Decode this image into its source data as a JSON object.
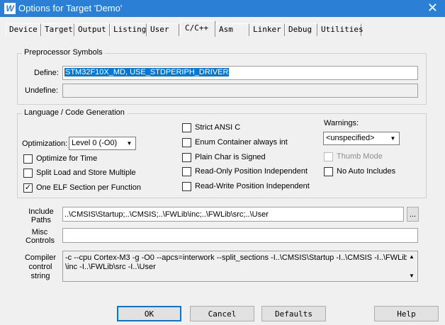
{
  "window": {
    "title": "Options for Target 'Demo'",
    "icon": "uvision-app-icon",
    "close_glyph": "✕"
  },
  "tabs": [
    {
      "label": "Device"
    },
    {
      "label": "Target"
    },
    {
      "label": "Output"
    },
    {
      "label": "Listing"
    },
    {
      "label": "User"
    },
    {
      "label": "C/C++"
    },
    {
      "label": "Asm"
    },
    {
      "label": "Linker"
    },
    {
      "label": "Debug"
    },
    {
      "label": "Utilities"
    }
  ],
  "active_tab": "C/C++",
  "preprocessor": {
    "title": "Preprocessor Symbols",
    "define_label": "Define:",
    "define_value": "STM32F10X_MD, USE_STDPERIPH_DRIVER",
    "undefine_label": "Undefine:",
    "undefine_value": ""
  },
  "language": {
    "title": "Language / Code Generation",
    "optimization_label": "Optimization:",
    "optimization_value": "Level 0 (-O0)",
    "optimize_time": {
      "label": "Optimize for Time",
      "checked": false
    },
    "split_load": {
      "label": "Split Load and Store Multiple",
      "checked": false
    },
    "one_elf": {
      "label": "One ELF Section per Function",
      "checked": true,
      "mark": "✓"
    },
    "strict_ansi": {
      "label": "Strict ANSI C",
      "checked": false
    },
    "enum_container": {
      "label": "Enum Container always int",
      "checked": false
    },
    "plain_char": {
      "label": "Plain Char is Signed",
      "checked": false
    },
    "ro_pos": {
      "label": "Read-Only Position Independent",
      "checked": false
    },
    "rw_pos": {
      "label": "Read-Write Position Independent",
      "checked": false
    },
    "warnings_label": "Warnings:",
    "warnings_value": "<unspecified>",
    "thumb_mode": {
      "label": "Thumb Mode",
      "checked": false,
      "disabled": true
    },
    "no_auto_includes": {
      "label": "No Auto Includes",
      "checked": false
    }
  },
  "include_paths": {
    "label_line1": "Include",
    "label_line2": "Paths",
    "value": "..\\CMSIS\\Startup;..\\CMSIS;..\\FWLib\\inc;..\\FWLib\\src;..\\User",
    "browse_label": "..."
  },
  "misc_controls": {
    "label_line1": "Misc",
    "label_line2": "Controls",
    "value": ""
  },
  "compiler_string": {
    "label_line1": "Compiler",
    "label_line2": "control",
    "label_line3": "string",
    "value": "-c --cpu Cortex-M3 -g -O0 --apcs=interwork --split_sections -I..\\CMSIS\\Startup -I..\\CMSIS -I..\\FWLib\n\\inc -I..\\FWLib\\src -I..\\User"
  },
  "buttons": {
    "ok": "OK",
    "cancel": "Cancel",
    "defaults": "Defaults",
    "help": "Help"
  }
}
